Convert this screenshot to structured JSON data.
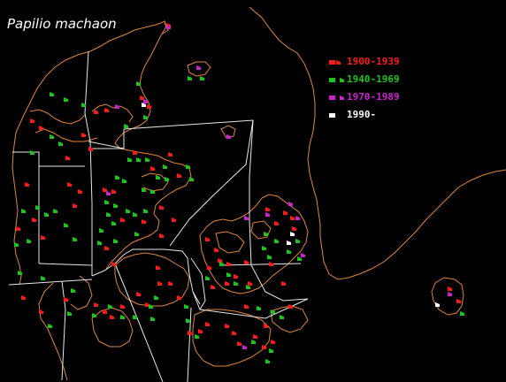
{
  "title": "Papilio machaon",
  "colors": {
    "background": "#000000",
    "coastline": "#e0853a",
    "borders": "#e8e8e8"
  },
  "legend": [
    {
      "label": "1900-1939",
      "color": "#ff1a1a"
    },
    {
      "label": "1940-1969",
      "color": "#19c619"
    },
    {
      "label": "1970-1989",
      "color": "#cc22cc"
    },
    {
      "label": "1990-",
      "color": "#ffffff"
    }
  ],
  "records": [
    {
      "period": "1900-1939",
      "count": 74
    },
    {
      "period": "1940-1969",
      "count": 78
    },
    {
      "period": "1970-1989",
      "count": 13
    },
    {
      "period": "1990-",
      "count": 5
    }
  ]
}
